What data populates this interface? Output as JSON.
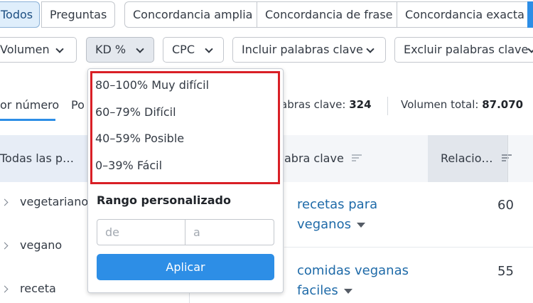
{
  "match_tabs": [
    "Todos",
    "Preguntas",
    "Concordancia amplia",
    "Concordancia de frase",
    "Concordancia exacta"
  ],
  "filters": [
    "Volumen",
    "KD %",
    "CPC",
    "Incluir palabras clave",
    "Excluir palabras clave"
  ],
  "group_tabs": [
    "or número",
    "Po"
  ],
  "stats": {
    "keywords_label": "abras clave:",
    "keywords_value": "324",
    "volume_label": "Volumen total:",
    "volume_value": "87.070"
  },
  "groups_panel": {
    "header": "Todas las p…",
    "items": [
      "vegetariano",
      "vegano",
      "receta"
    ]
  },
  "table": {
    "keyword_header": "abra clave",
    "related_header": "Relacio…",
    "rows": [
      {
        "line1": "recetas para",
        "line2": "veganos",
        "value": "60"
      },
      {
        "line1": "comidas veganas",
        "line2": "faciles",
        "value": "55"
      }
    ]
  },
  "kd_dropdown": {
    "options": [
      "80–100% Muy difícil",
      "60–79% Difícil",
      "40–59% Posible",
      "0–39% Fácil"
    ],
    "custom_title": "Rango personalizado",
    "from_placeholder": "de",
    "to_placeholder": "a",
    "apply_label": "Aplicar"
  },
  "colors": {
    "accent": "#2d8ee6",
    "link": "#1e6aa8",
    "highlight": "#d91f26"
  }
}
